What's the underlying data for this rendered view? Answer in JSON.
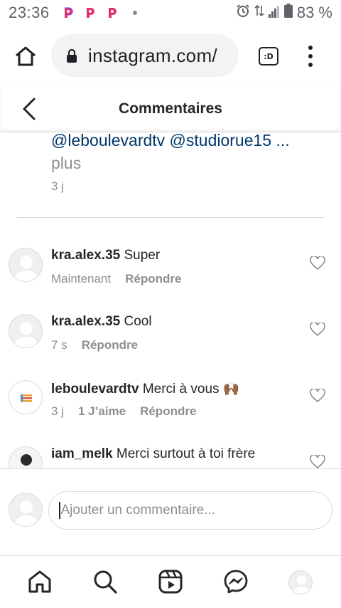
{
  "status_bar": {
    "time": "23:36",
    "battery": "83 %",
    "app_icons": [
      "p-app-icon",
      "p-app-icon",
      "p-app-icon"
    ],
    "accent": "#e1306c"
  },
  "browser": {
    "url": "instagram.com/",
    "tab_switcher_label": ":D"
  },
  "header": {
    "title": "Commentaires"
  },
  "caption": {
    "tags": "@leboulevardtv @studiorue15 ...",
    "more": "plus",
    "time": "3 j"
  },
  "comments": [
    {
      "username": "kra.alex.35",
      "text": "Super",
      "time": "Maintenant",
      "likes": "",
      "reply": "Répondre",
      "avatar": "default"
    },
    {
      "username": "kra.alex.35",
      "text": "Cool",
      "time": "7 s",
      "likes": "",
      "reply": "Répondre",
      "avatar": "default"
    },
    {
      "username": "leboulevardtv",
      "text": "Merci à vous 🙌🏾",
      "time": "3 j",
      "likes": "1 J’aime",
      "reply": "Répondre",
      "avatar": "brand"
    },
    {
      "username": "iam_melk",
      "text": "Merci surtout à toi frère",
      "time": "",
      "likes": "",
      "reply": "",
      "avatar": "photo"
    }
  ],
  "composer": {
    "placeholder": "Ajouter un commentaire..."
  },
  "bottom_nav": [
    "home-icon",
    "search-icon",
    "reels-icon",
    "messenger-icon",
    "profile-avatar"
  ],
  "colors": {
    "link": "#00376b",
    "muted": "#8e8e8e",
    "text": "#262626",
    "border": "#dbdbdb"
  }
}
